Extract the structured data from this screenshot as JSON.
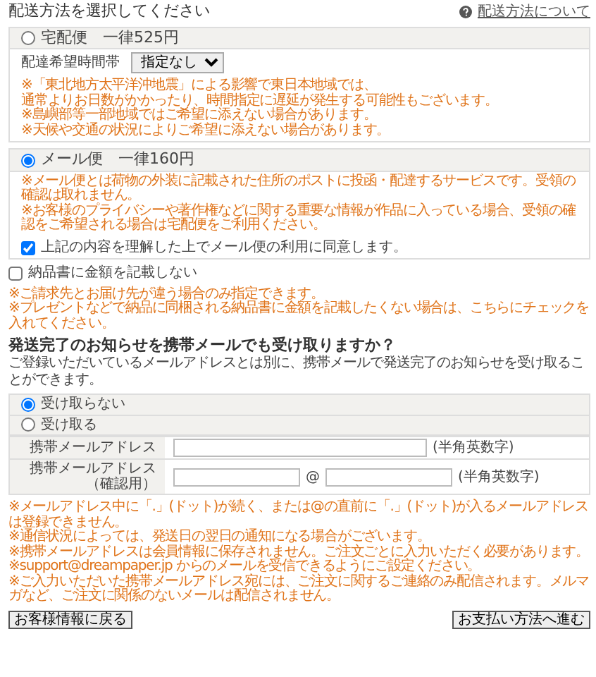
{
  "title": "配送方法を選択してください",
  "help_link": "配送方法について",
  "shipping_options": [
    {
      "label": "宅配便　一律525円",
      "selected": false,
      "time_field": {
        "label": "配達希望時間帯",
        "value": "指定なし"
      },
      "notes": [
        "※「東北地方太平洋沖地震」による影響で東日本地域では、",
        "通常よりお日数がかかったり、時間指定に遅延が発生する可能性もございます。",
        "※島嶼部等一部地域ではご希望に添えない場合があります。",
        "※天候や交通の状況によりご希望に添えない場合があります。"
      ]
    },
    {
      "label": "メール便　一律160円",
      "selected": true,
      "notes": [
        "※メール便とは荷物の外装に記載された住所のポストに投函・配達するサービスです。受領の確認は取れません。",
        "※お客様のプライバシーや著作権などに関する重要な情報が作品に入っている場合、受領の確認をご希望される場合は宅配便をご利用ください。"
      ],
      "agreement": {
        "label": "上記の内容を理解した上でメール便の利用に同意します。",
        "checked": true
      }
    }
  ],
  "invoice_option": {
    "label": "納品書に金額を記載しない",
    "checked": false,
    "notes": [
      "※ご請求先とお届け先が違う場合のみ指定できます。",
      "※プレゼントなどで納品に同梱される納品書に金額を記載したくない場合は、こちらにチェックを入れてください。"
    ]
  },
  "notification": {
    "heading": "発送完了のお知らせを携帯メールでも受け取りますか？",
    "description": "ご登録いただいているメールアドレスとは別に、携帯メールで発送完了のお知らせを受け取ることができます。",
    "options": [
      {
        "label": "受け取らない",
        "selected": true
      },
      {
        "label": "受け取る",
        "selected": false
      }
    ],
    "fields": [
      {
        "kind": "single",
        "label": "携帯メールアドレス",
        "hint": "(半角英数字)"
      },
      {
        "kind": "split",
        "label": "携帯メールアドレス",
        "sublabel": "（確認用）",
        "separator": "@",
        "hint": "(半角英数字)"
      }
    ],
    "notes": [
      "※メールアドレス中に「.」(ドット)が続く、または@の直前に「.」(ドット)が入るメールアドレスは登録できません。",
      "※通信状況によっては、発送日の翌日の通知になる場合がございます。",
      "※携帯メールアドレスは会員情報に保存されません。ご注文ごとに入力いただく必要があります。",
      "※support@dreampaper.jp からのメールを受信できるようにご設定ください。",
      "※ご入力いただいた携帯メールアドレス宛には、ご注文に関するご連絡のみ配信されます。メルマガなど、ご注文に関係のないメールは配信されません。"
    ]
  },
  "buttons": [
    {
      "label": "お客様情報に戻る"
    },
    {
      "label": "お支払い方法へ進む"
    }
  ]
}
